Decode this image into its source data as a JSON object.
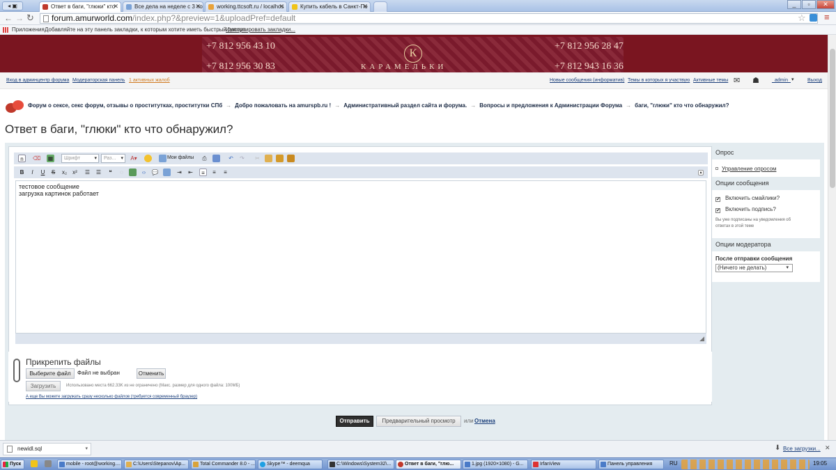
{
  "browser": {
    "tabs": [
      {
        "label": "Ответ в баги, \"глюки\" кто",
        "active": true,
        "color": "#c0392b"
      },
      {
        "label": "Все дела на неделе с 3 по",
        "active": false,
        "color": "#7aa2d6"
      },
      {
        "label": "working.ttcsoft.ru / localhos",
        "active": false,
        "color": "#e8a23a"
      },
      {
        "label": "Купить кабель в Санкт-Пе",
        "active": false,
        "color": "#f0c419"
      }
    ],
    "url_host": "forum.amurworld.com",
    "url_path": "/index.php?&preview=1&uploadPref=default",
    "bookmarks": {
      "apps": "Приложения",
      "hint": "Добавляйте на эту панель закладки, к которым хотите иметь быстрый доступ.",
      "import": "Импортировать закладки..."
    }
  },
  "banner": {
    "phones": [
      "+7 812 956 43 10",
      "+7 812 956 30 83",
      "+7 812 956 28 47",
      "+7 812 943 16 36"
    ],
    "brand": "КАРАМЕЛЬКИ",
    "logo_letter": "К"
  },
  "topnav": {
    "admin_cp": "Вход в админцентр форума",
    "mod_panel": "Модераторская панель",
    "warnings": "1 активных жалоб",
    "new_posts": "Новые сообщения (информатив)",
    "my_topics": "Темы в которых я участвую",
    "active": "Активные темы",
    "user": "_admin_",
    "logout": "Выход"
  },
  "breadcrumbs": [
    "Форум о сексе, секс форум, отзывы о проститутках, проститутки СПб",
    "Добро пожаловать на amurspb.ru !",
    "Административный раздел сайта и форума.",
    "Вопросы и предложения к Администрации Форума",
    "баги, \"глюки\" кто что обнаружил?"
  ],
  "page_title": "Ответ в баги, \"глюки\" кто что обнаружил?",
  "editor": {
    "font_select": "Шрифт",
    "size_select": "Раз...",
    "my_files": "Мои файлы",
    "text_lines": [
      "тестовое сообщение",
      "загрузка картинок работает"
    ]
  },
  "sidebar": {
    "poll_header": "Опрос",
    "poll_manage": "Управление опросом",
    "options_header": "Опции сообщения",
    "enable_smilies": "Включить смайлики?",
    "enable_signature": "Включить подпись?",
    "subscribed_note_1": "Вы уже подписаны на уведомления об",
    "subscribed_note_2": "ответах в этой теме",
    "mod_header": "Опции модератора",
    "after_post": "После отправки сообщения",
    "after_select": "(Ничего не делать)"
  },
  "attach": {
    "title": "Прикрепить файлы",
    "choose": "Выберите файл",
    "no_file": "Файл не выбран",
    "cancel": "Отменить",
    "upload": "Загрузить",
    "usage": "Использовано места 662.33K из не ограничено (Макс. размер для одного файла: 100МБ)",
    "multi_link": "А еще Вы можете загружать сразу несколько файлов (требуется современный браузер)"
  },
  "actions": {
    "submit": "Отправить",
    "preview": "Предварительный просмотр",
    "or": "или",
    "cancel": "Отмена"
  },
  "downloads": {
    "file": "newidl.sql",
    "all": "Все загрузки..."
  },
  "taskbar": {
    "start": "Пуск",
    "tasks": [
      {
        "label": "mobile - root@working....",
        "color": "#4a7bc8"
      },
      {
        "label": "C:\\Users\\Stepanov\\Ap...",
        "color": "#e0b050"
      },
      {
        "label": "Total Commander 8.0 - ...",
        "color": "#d9a33a"
      },
      {
        "label": "Skype™ - deemqua",
        "color": "#1fa0e3"
      },
      {
        "label": "C:\\Windows\\System32\\...",
        "color": "#333333"
      },
      {
        "label": "Ответ в баги, \"глю...",
        "color": "#c0392b"
      },
      {
        "label": "1.jpg (1920×1080) - G...",
        "color": "#4a7bc8"
      },
      {
        "label": "IrfanView",
        "color": "#d33"
      },
      {
        "label": "Панель управления",
        "color": "#4a7bc8"
      }
    ],
    "lang": "RU",
    "time": "19:05"
  }
}
